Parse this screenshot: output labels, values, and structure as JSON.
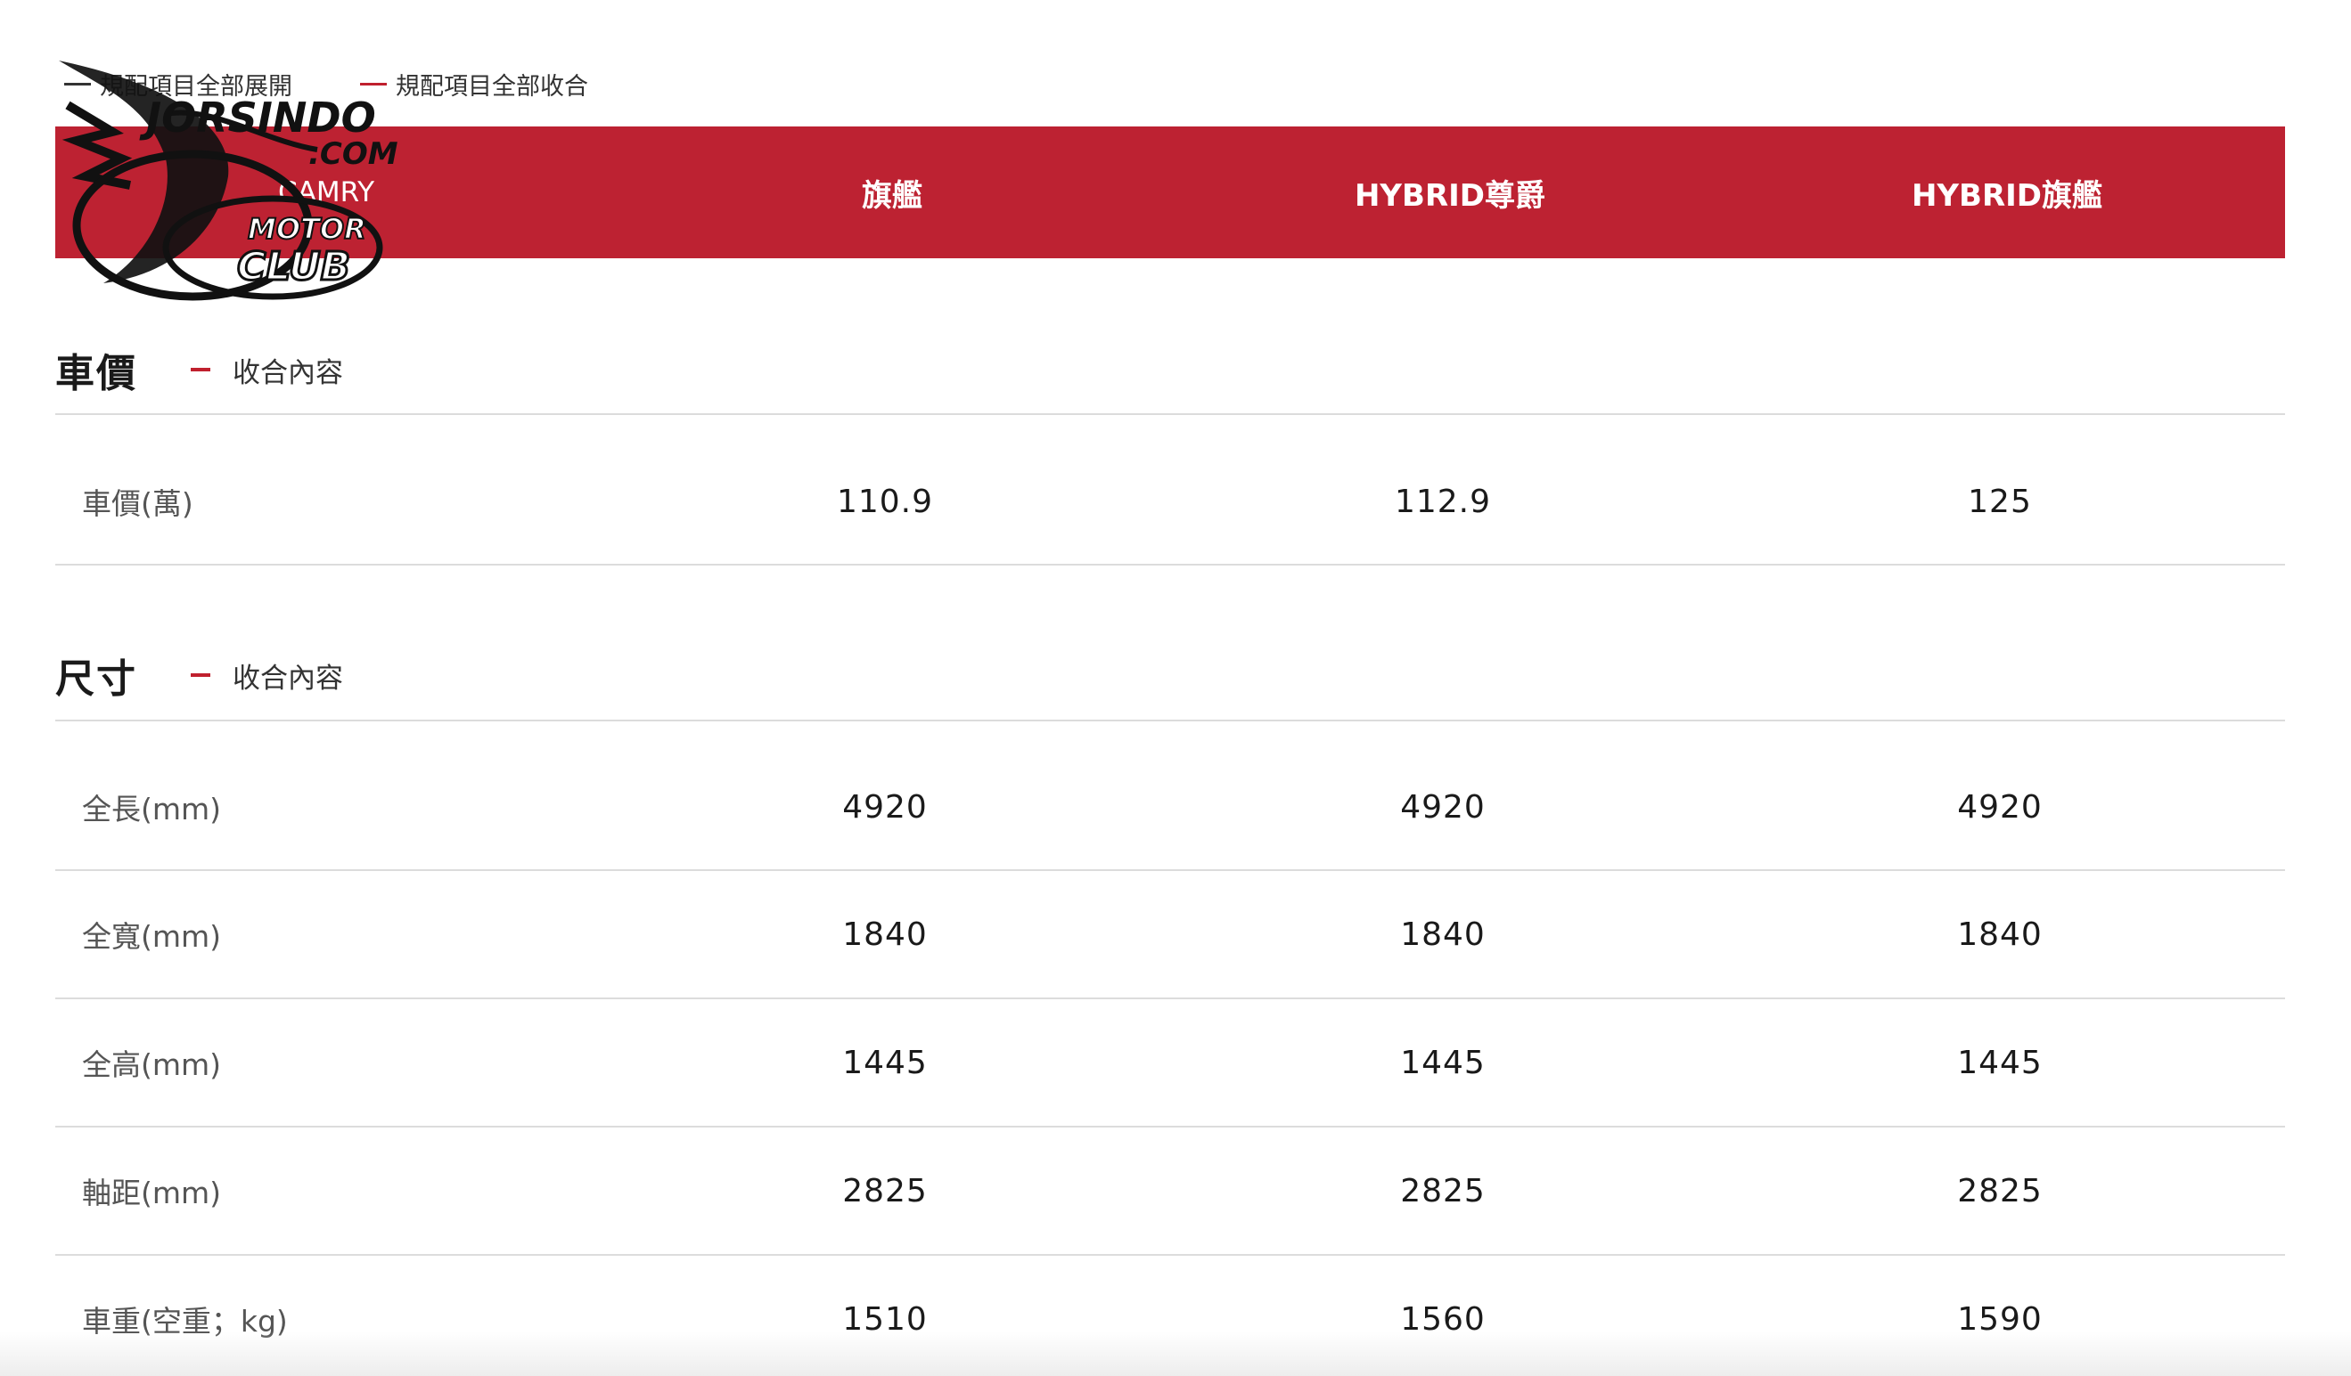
{
  "controls": {
    "expand_all": "規配項目全部展開",
    "collapse_all": "規配項目全部收合"
  },
  "header": {
    "col0": "CAMRY",
    "col1": "旗艦",
    "col2": "HYBRID尊爵",
    "col3": "HYBRID旗艦"
  },
  "watermark": {
    "line1": "JORSINDO",
    "line2": ".COM",
    "line3": "MOTOR",
    "line4": "CLUB"
  },
  "sections": [
    {
      "title": "車價",
      "toggle": "收合內容",
      "rows": [
        {
          "label": "車價(萬)",
          "values": [
            "110.9",
            "112.9",
            "125"
          ]
        }
      ]
    },
    {
      "title": "尺寸",
      "toggle": "收合內容",
      "rows": [
        {
          "label": "全長(mm)",
          "values": [
            "4920",
            "4920",
            "4920"
          ]
        },
        {
          "label": "全寬(mm)",
          "values": [
            "1840",
            "1840",
            "1840"
          ]
        },
        {
          "label": "全高(mm)",
          "values": [
            "1445",
            "1445",
            "1445"
          ]
        },
        {
          "label": "軸距(mm)",
          "values": [
            "2825",
            "2825",
            "2825"
          ]
        },
        {
          "label": "車重(空重；kg)",
          "values": [
            "1510",
            "1560",
            "1590"
          ]
        }
      ]
    }
  ],
  "colors": {
    "header_bg": "#bd2232",
    "accent": "#c0202e"
  }
}
